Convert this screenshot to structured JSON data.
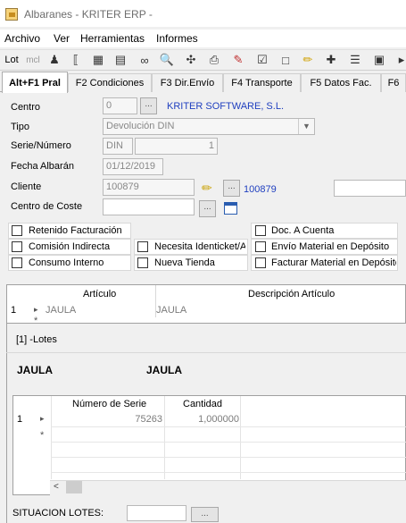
{
  "window": {
    "title": "Albaranes - KRITER ERP -"
  },
  "menu": {
    "items": [
      "Archivo",
      "Ver",
      "Herramientas",
      "Informes"
    ]
  },
  "toolbar": {
    "lot_label": "Lot",
    "mcl_label": "mcl"
  },
  "tabs": [
    {
      "label": "Alt+F1 Pral",
      "active": true
    },
    {
      "label": "F2 Condiciones"
    },
    {
      "label": "F3 Dir.Envío"
    },
    {
      "label": "F4 Transporte"
    },
    {
      "label": "F5 Datos Fac."
    },
    {
      "label": "F6"
    }
  ],
  "form": {
    "centro": {
      "label": "Centro",
      "value": "0",
      "name": "KRITER SOFTWARE, S.L."
    },
    "tipo": {
      "label": "Tipo",
      "value": "Devolución DIN"
    },
    "serie_numero": {
      "label": "Serie/Número",
      "serie": "DIN",
      "numero": "1"
    },
    "fecha": {
      "label": "Fecha Albarán",
      "value": "01/12/2019"
    },
    "cliente": {
      "label": "Cliente",
      "value": "100879",
      "code_link": "100879"
    },
    "centro_coste": {
      "label": "Centro de Coste",
      "value": ""
    },
    "button_dots": "..."
  },
  "checkboxes": {
    "row1": [
      "Retenido Facturación",
      "Doc. A Cuenta"
    ],
    "row2": [
      "Comisión Indirecta",
      "Necesita Identicket/A",
      "Envío Material en Depósito"
    ],
    "row3": [
      "Consumo Interno",
      "Nueva Tienda",
      "Facturar Material en Depósito"
    ]
  },
  "articles_grid": {
    "columns": [
      "Artículo",
      "Descripción Artículo"
    ],
    "rows": [
      {
        "index": "1",
        "articulo": "JAULA",
        "descripcion": "JAULA"
      }
    ],
    "new_row_marker": "*"
  },
  "lotes": {
    "title": "[1] -Lotes",
    "articulo": "JAULA",
    "descripcion": "JAULA",
    "columns": [
      "Número de Serie",
      "Cantidad"
    ],
    "rows": [
      {
        "index": "1",
        "numero_serie": "75263",
        "cantidad": "1,000000"
      }
    ],
    "new_row_marker": "*",
    "scroll_left": "<"
  },
  "situacion": {
    "label": "SITUACION LOTES:",
    "value": "",
    "button": "..."
  }
}
